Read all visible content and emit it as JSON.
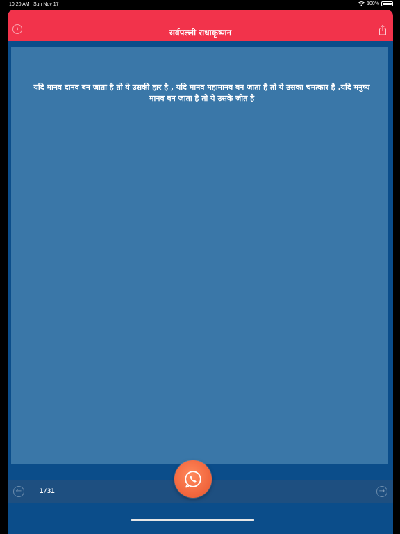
{
  "status_bar": {
    "time": "10:20 AM",
    "date": "Sun Nov 17",
    "battery": "100%"
  },
  "header": {
    "title": "सर्वपल्ली राधाकृष्णन",
    "background": "#f2334b"
  },
  "quote": {
    "text": "यदि मानव दानव बन जाता है तो ये उसकी हार है , यदि मानव महामानव बन जाता है तो ये उसका चमत्कार है .यदि मनुष्य मानव बन जाता है तो ये उसके जीत है"
  },
  "footer": {
    "page_count": "1/31"
  },
  "colors": {
    "card": "#3a77a8",
    "page_background": "#0b4d8a",
    "share_button": "#f2683f"
  },
  "icons": {
    "back": "chevron-left-icon",
    "share": "share-icon",
    "prev": "arrow-left-icon",
    "next": "arrow-right-icon",
    "whatsapp": "whatsapp-icon"
  }
}
